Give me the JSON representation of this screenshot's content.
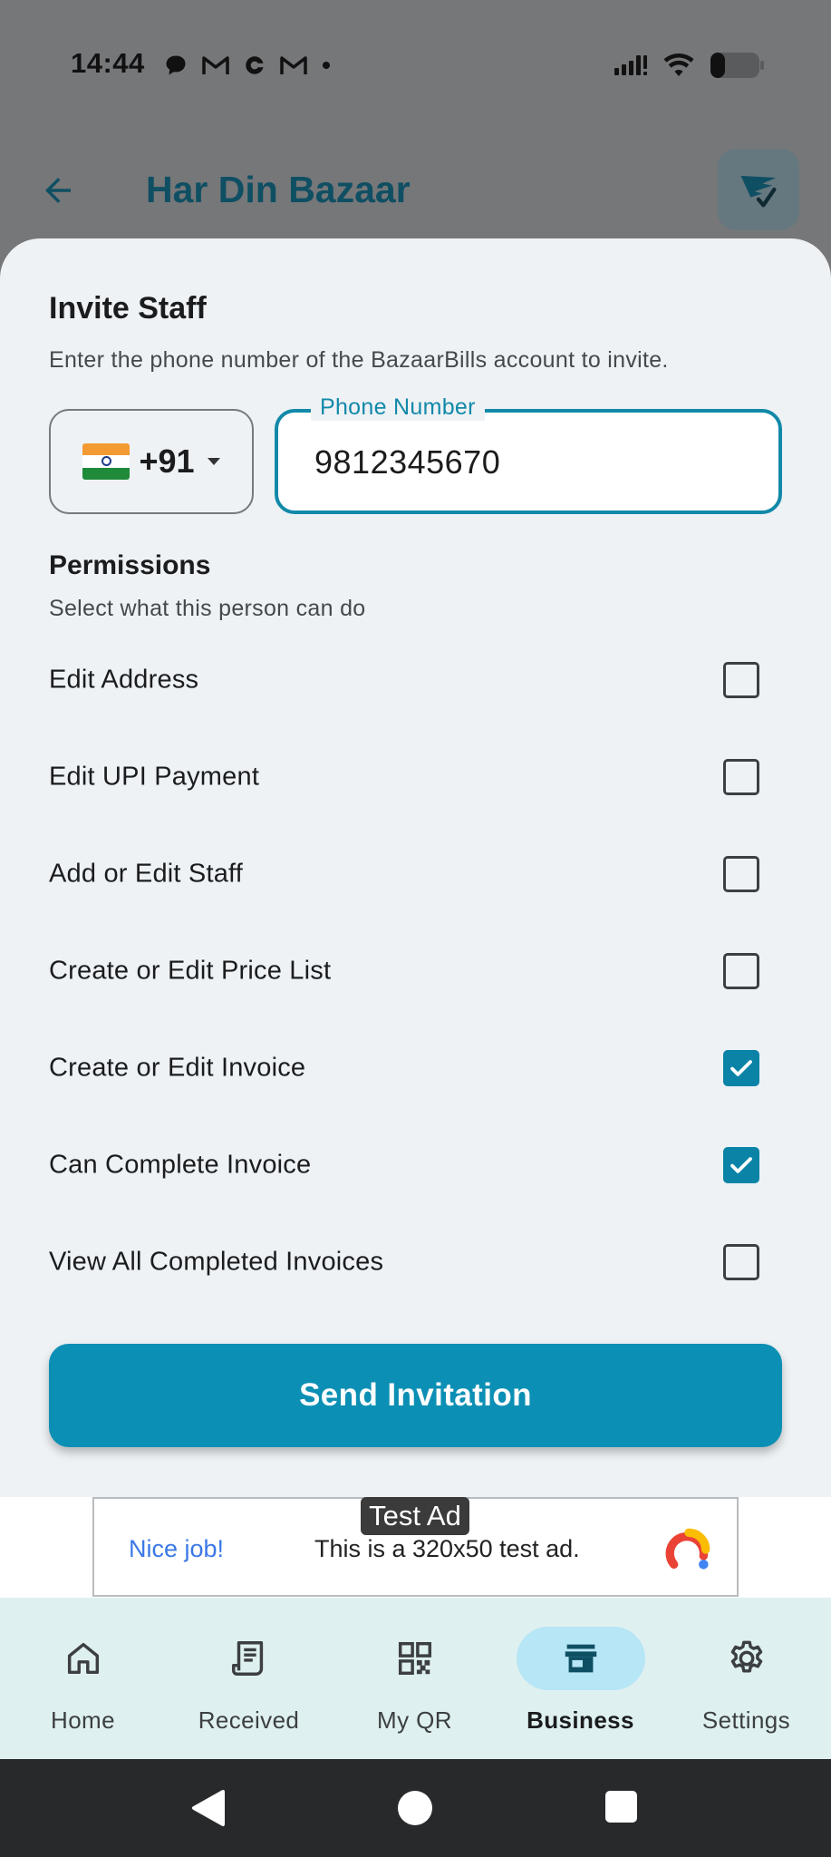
{
  "status_bar": {
    "time": "14:44",
    "left_icons": [
      "chat-bubble-icon",
      "gmail-icon",
      "c-app-icon",
      "gmail-icon",
      "dot-icon"
    ],
    "right_icons": [
      "signal-icon",
      "wifi-icon",
      "battery-icon"
    ]
  },
  "app_bar": {
    "title": "Har Din Bazaar",
    "back_icon": "arrow-back-icon",
    "logo_icon": "bazaarbills-logo-icon"
  },
  "invite_sheet": {
    "title": "Invite Staff",
    "subtitle": "Enter the phone number of the BazaarBills account to invite.",
    "country_code": "+91",
    "country_flag": "india-flag-icon",
    "phone_label": "Phone Number",
    "phone_value": "9812345670",
    "permissions_heading": "Permissions",
    "permissions_subtitle": "Select what this person can do",
    "permissions": [
      {
        "label": "Edit Address",
        "checked": false
      },
      {
        "label": "Edit UPI Payment",
        "checked": false
      },
      {
        "label": "Add or Edit Staff",
        "checked": false
      },
      {
        "label": "Create or Edit Price List",
        "checked": false
      },
      {
        "label": "Create or Edit Invoice",
        "checked": true
      },
      {
        "label": "Can Complete Invoice",
        "checked": true
      },
      {
        "label": "View All Completed Invoices",
        "checked": false
      }
    ],
    "send_button": "Send Invitation"
  },
  "ad": {
    "badge": "Test Ad",
    "nice": "Nice job!",
    "text": "This is a 320x50 test ad."
  },
  "bottom_nav": {
    "items": [
      {
        "label": "Home",
        "icon": "home-icon",
        "active": false
      },
      {
        "label": "Received",
        "icon": "receipt-icon",
        "active": false
      },
      {
        "label": "My QR",
        "icon": "qr-code-icon",
        "active": false
      },
      {
        "label": "Business",
        "icon": "store-icon",
        "active": true
      },
      {
        "label": "Settings",
        "icon": "gear-icon",
        "active": false
      }
    ]
  },
  "colors": {
    "accent": "#0c8fb4",
    "sheet_bg": "#eef2f5",
    "nav_bg": "#dff0f0",
    "active_pill": "#b7e6f6"
  }
}
